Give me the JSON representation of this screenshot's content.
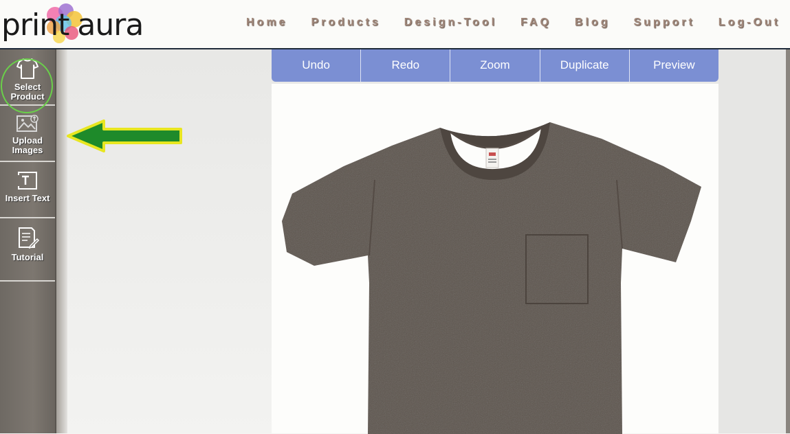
{
  "brand": {
    "logo_text_left": "print",
    "logo_text_right": "aura"
  },
  "nav": [
    {
      "label": "Home"
    },
    {
      "label": "Products"
    },
    {
      "label": "Design-Tool"
    },
    {
      "label": "FAQ"
    },
    {
      "label": "Blog"
    },
    {
      "label": "Support"
    },
    {
      "label": "Log-Out"
    }
  ],
  "sidebar": {
    "items": [
      {
        "label": "Select Product",
        "icon": "tshirt-icon"
      },
      {
        "label": "Upload Images",
        "icon": "image-upload-icon",
        "highlighted": true
      },
      {
        "label": "Insert Text",
        "icon": "text-icon"
      },
      {
        "label": "Tutorial",
        "icon": "document-pencil-icon"
      }
    ]
  },
  "toolbar": {
    "buttons": [
      {
        "label": "Undo"
      },
      {
        "label": "Redo"
      },
      {
        "label": "Zoom"
      },
      {
        "label": "Duplicate"
      },
      {
        "label": "Preview"
      }
    ]
  },
  "colors": {
    "toolbar_bg": "#7b8fd3",
    "sidebar_bg": "#757069",
    "highlight_green": "#6ad04a",
    "arrow_fill": "#1e8a2a",
    "arrow_outline": "#e8e620",
    "shirt": "#5f5650"
  }
}
